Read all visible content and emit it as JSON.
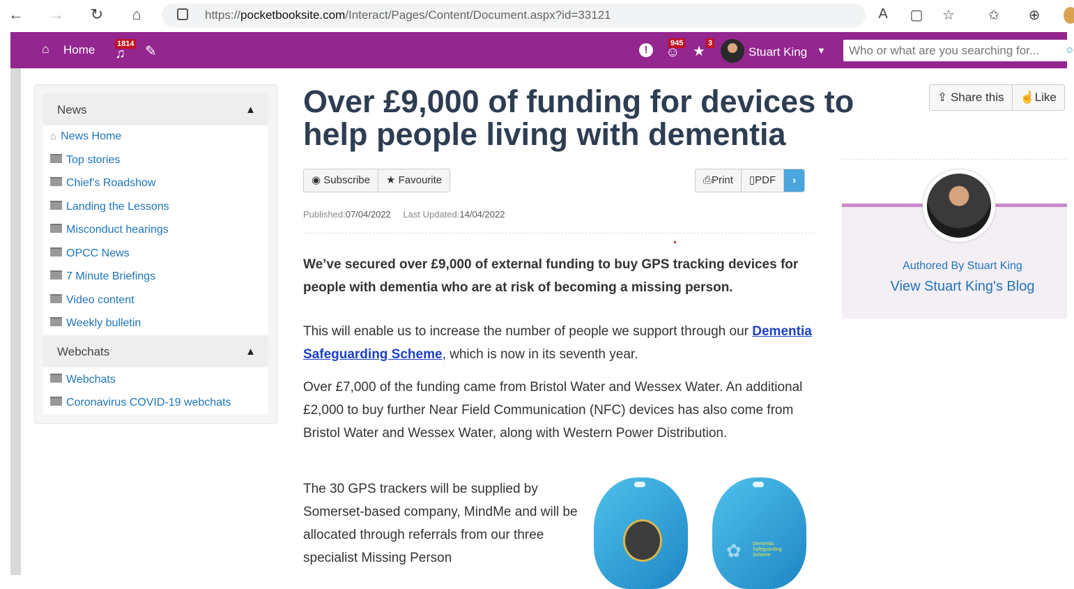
{
  "browser": {
    "url_prefix": "https://",
    "url_host": "pocketbooksite.com",
    "url_path": "/Interact/Pages/Content/Document.aspx?id=33121",
    "back_icon": "←",
    "forward_icon": "→",
    "refresh_icon": "↻",
    "home_icon": "⌂",
    "read_aloud_icon": "A",
    "reader_icon": "▢",
    "favorite_icon": "☆",
    "favorites_icon": "✩",
    "collections_icon": "⊕"
  },
  "appbar": {
    "home_label": "Home",
    "notifications_count": "1814",
    "alerts_count": "945",
    "favourites_count": "3",
    "user_name": "Stuart King",
    "search_placeholder": "Who or what are you searching for..."
  },
  "sidebar": {
    "news_heading": "News",
    "news_items": [
      {
        "label": "News Home"
      },
      {
        "label": "Top stories"
      },
      {
        "label": "Chief's Roadshow"
      },
      {
        "label": "Landing the Lessons"
      },
      {
        "label": "Misconduct hearings"
      },
      {
        "label": "OPCC News"
      },
      {
        "label": "7 Minute Briefings"
      },
      {
        "label": "Video content"
      },
      {
        "label": "Weekly bulletin"
      }
    ],
    "webchats_heading": "Webchats",
    "webchat_items": [
      {
        "label": "Webchats"
      },
      {
        "label": "Coronavirus COVID-19 webchats"
      }
    ]
  },
  "article": {
    "title": "Over £9,000 of funding for devices to help people living with dementia",
    "subscribe_label": "Subscribe",
    "favourite_label": "Favourite",
    "print_label": "Print",
    "pdf_label": "PDF",
    "published_label": "Published:",
    "published_date": "07/04/2022",
    "updated_label": "Last Updated:",
    "updated_date": "14/04/2022",
    "lead": "We’ve secured over £9,000 of external funding to buy GPS tracking devices for people with dementia who are at risk of becoming a missing person.",
    "para1_before": "This will enable us to increase the number of people we support through our ",
    "para1_link": "Dementia Safeguarding Scheme",
    "para1_after": ", which is now in its seventh year.",
    "para2": "Over £7,000 of the funding came from Bristol Water and Wessex Water. An additional £2,000 to buy further Near Field Communication (NFC) devices has also come from Bristol Water and Wessex Water, along with Western Power Distribution.",
    "para3": "The 30 GPS trackers will be supplied by Somerset-based company, MindMe and will be allocated through referrals from our three specialist Missing Person",
    "tracker_text": "Dementia Safeguarding Scheme"
  },
  "right_panel": {
    "share_label": "Share this",
    "like_label": "Like",
    "authored_by": "Authored By Stuart King",
    "blog_link": "View Stuart King's Blog"
  },
  "colors": {
    "appbar": "#93268f",
    "link": "#1f74b8",
    "title": "#2d3d52",
    "badge": "#c1121f"
  }
}
